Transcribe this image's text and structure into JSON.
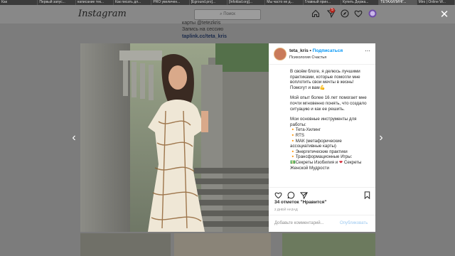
{
  "browser": {
    "tabs": [
      {
        "label": "Как"
      },
      {
        "label": "Первый запус..."
      },
      {
        "label": "написание тек..."
      },
      {
        "label": "Как писать дл..."
      },
      {
        "label": "PRO увеличен..."
      },
      {
        "label": "[Eground.pro]..."
      },
      {
        "label": "[Infoklad.org]..."
      },
      {
        "label": "Мы часто не д..."
      },
      {
        "label": "Главный прин..."
      },
      {
        "label": "Купить Держа..."
      },
      {
        "label": "TETAХИЛИНГ..."
      },
      {
        "label": "Miro | Online W..."
      }
    ],
    "active_tab": 10
  },
  "header": {
    "logo": "Instagram",
    "search_placeholder": "Поиск",
    "notification_count": "5",
    "icons": [
      "home-icon",
      "direct-icon",
      "explore-icon",
      "heart-icon",
      "profile-icon"
    ]
  },
  "background": {
    "line1": "карты @tetezkris",
    "line2": "Запись на сессию",
    "link": "taplink.cc/teta_kris"
  },
  "post": {
    "username": "teta_kris",
    "separator": " • ",
    "follow": "Подписаться",
    "subtitle": "Психология Счастья",
    "caption": {
      "p1": "В своём блоге, я делюсь лучшими практиками, которые помогли мне воплотить свои мечты в жизнь! Помогут и вам",
      "p2": "Мой опыт более 16 лет помогает мне почти мгновенно понять, что создало ситуацию и как ее решить.",
      "p3_intro": "Мои основные инструменты для работы:",
      "tools": [
        "Тета-Хилинг",
        "RTS",
        "МАК (метафорические ассоциативные карты)",
        "Энергетические практики",
        "Трансформационные Игры:",
        "Секреты Изобилия и",
        "Секреты Женской Мудрости"
      ]
    },
    "likes": "34 отметок \"Нравится\"",
    "date": "2 ДНЕЙ НАЗАД",
    "comment_placeholder": "Добавьте комментарий...",
    "publish": "Опубликовать"
  },
  "colors": {
    "accent": "#0095f6",
    "header_bg": "#888888",
    "panel_bg": "#ffffff"
  }
}
